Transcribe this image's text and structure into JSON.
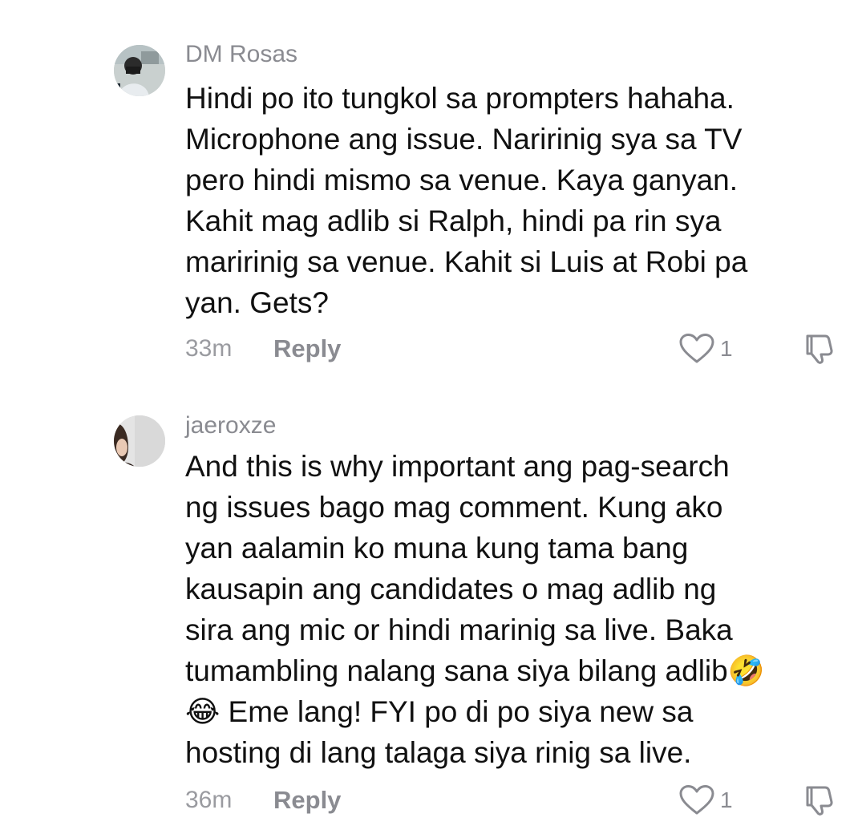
{
  "comments": [
    {
      "username": "DM Rosas",
      "text": "Hindi po ito tungkol sa prompters hahaha.\nMicrophone ang issue. Naririnig sya sa TV\npero hindi mismo sa venue. Kaya ganyan.\nKahit mag adlib si Ralph, hindi pa rin sya\nmaririnig sa venue. Kahit si Luis at Robi pa\nyan. Gets?",
      "time": "33m",
      "reply_label": "Reply",
      "like_count": "1",
      "avatar_icon": "user-avatar-icon"
    },
    {
      "username": "jaeroxze",
      "text": "And this is why important ang pag-search\nng issues bago mag comment. Kung ako\nyan aalamin ko muna kung tama bang\nkausapin ang candidates o mag adlib ng\nsira ang mic or hindi marinig sa live. Baka\ntumambling nalang sana siya bilang adlib🤣\n😂 Eme lang! FYI po di po siya new sa\nhosting di lang talaga siya rinig sa live.",
      "time": "36m",
      "reply_label": "Reply",
      "like_count": "1",
      "avatar_icon": "user-avatar-icon"
    }
  ],
  "icons": {
    "like": "heart-outline-icon",
    "dislike": "thumbs-down-icon"
  },
  "colors": {
    "text": "#111111",
    "muted": "#8a8b91",
    "background": "#ffffff"
  }
}
